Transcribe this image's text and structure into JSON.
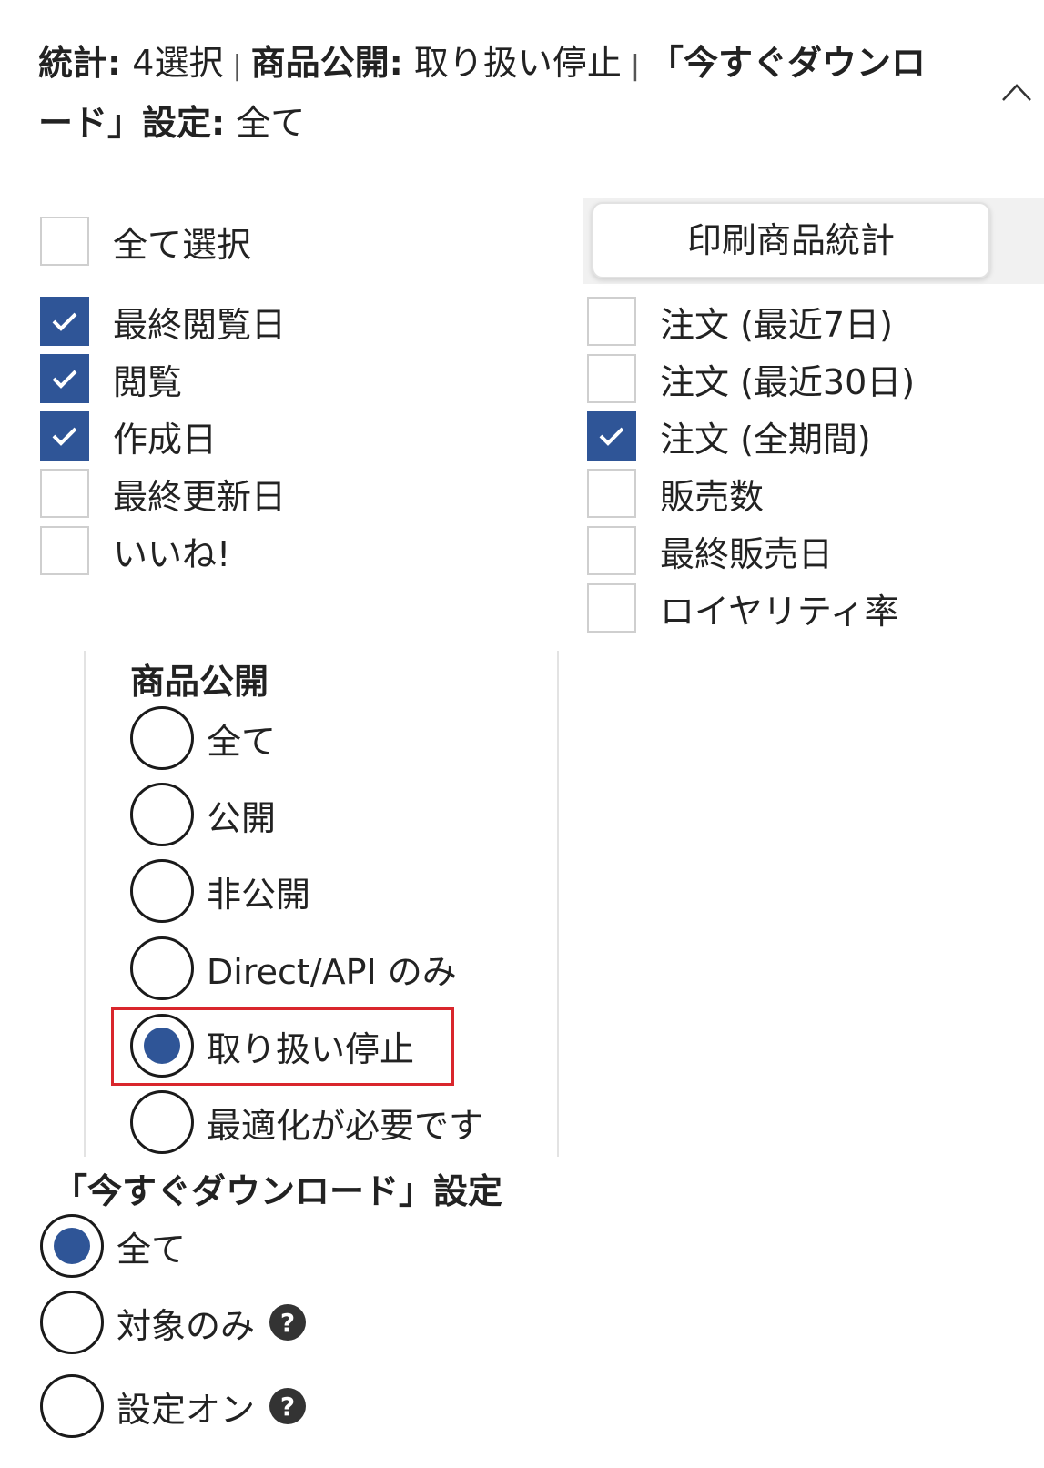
{
  "summary": {
    "stats_label": "統計:",
    "stats_value": "4選択",
    "separator": "|",
    "publication_label": "商品公開:",
    "publication_value": "取り扱い停止",
    "download_label": "「今すぐダウンロード」設定:",
    "download_value": "全て"
  },
  "icons": {
    "collapse": "chevron-up-icon",
    "check": "check-icon",
    "help": "question-mark-icon"
  },
  "stats_checkboxes": {
    "select_all": {
      "label": "全て選択",
      "checked": false
    },
    "left": [
      {
        "label": "最終閲覧日",
        "checked": true
      },
      {
        "label": "閲覧",
        "checked": true
      },
      {
        "label": "作成日",
        "checked": true
      },
      {
        "label": "最終更新日",
        "checked": false
      },
      {
        "label": "いいね!",
        "checked": false
      }
    ],
    "right": [
      {
        "label": "注文 (最近7日)",
        "checked": false
      },
      {
        "label": "注文 (最近30日)",
        "checked": false
      },
      {
        "label": "注文 (全期間)",
        "checked": true
      },
      {
        "label": "販売数",
        "checked": false
      },
      {
        "label": "最終販売日",
        "checked": false
      },
      {
        "label": "ロイヤリティ率",
        "checked": false
      }
    ]
  },
  "print_stats_button": {
    "label": "印刷商品統計"
  },
  "publication": {
    "title": "商品公開",
    "options": [
      {
        "label": "全て",
        "selected": false
      },
      {
        "label": "公開",
        "selected": false
      },
      {
        "label": "非公開",
        "selected": false
      },
      {
        "label": "Direct/API のみ",
        "selected": false
      },
      {
        "label": "取り扱い停止",
        "selected": true,
        "highlighted": true
      },
      {
        "label": "最適化が必要です",
        "selected": false
      }
    ]
  },
  "download_setting": {
    "title": "「今すぐダウンロード」設定",
    "help_glyph": "?",
    "options": [
      {
        "label": "全て",
        "selected": true,
        "help": false
      },
      {
        "label": "対象のみ",
        "selected": false,
        "help": true
      },
      {
        "label": "設定オン",
        "selected": false,
        "help": true
      }
    ]
  },
  "colors": {
    "accent": "#2f5597",
    "highlight_border": "#d9262c",
    "checkbox_border": "#cfcfcf",
    "text": "#222222"
  }
}
